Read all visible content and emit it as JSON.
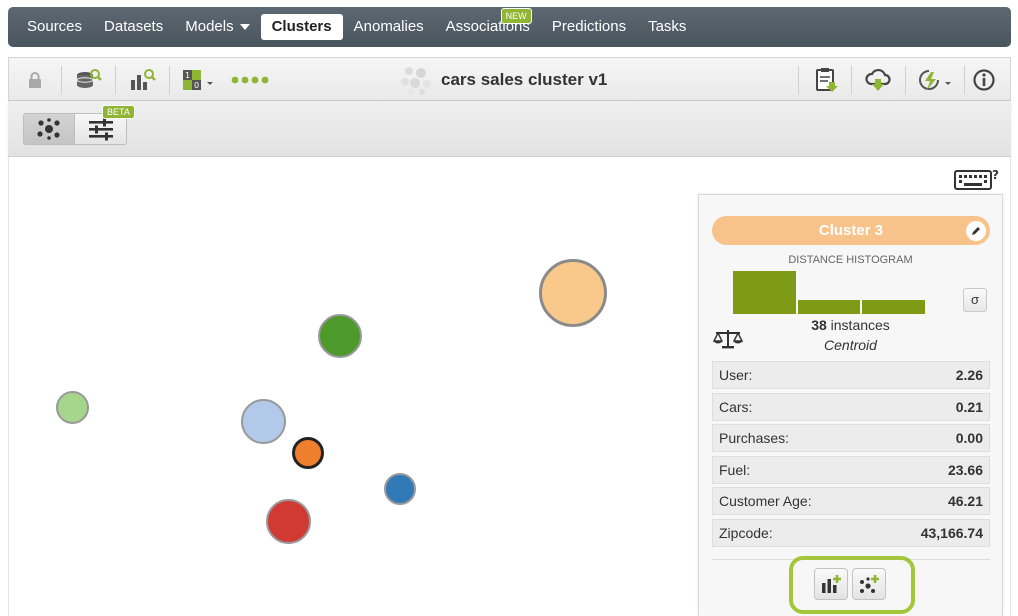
{
  "nav": {
    "items": [
      {
        "label": "Sources"
      },
      {
        "label": "Datasets"
      },
      {
        "label": "Models"
      },
      {
        "label": "Clusters"
      },
      {
        "label": "Anomalies"
      },
      {
        "label": "Associations"
      },
      {
        "label": "Predictions"
      },
      {
        "label": "Tasks"
      }
    ],
    "active": "Clusters",
    "new_badge": "NEW"
  },
  "toolbar": {
    "title": "cars sales cluster v1",
    "icons": [
      "lock-icon",
      "dataset-search-icon",
      "chart-search-icon",
      "binary-dropdown-icon",
      "dots-icon",
      "cluster-logo-icon",
      "report-download-icon",
      "cloud-download-icon",
      "lightning-dropdown-icon",
      "info-icon"
    ]
  },
  "subbar": {
    "beta_badge": "BETA",
    "views": [
      "cluster-view-icon",
      "sliders-view-icon"
    ]
  },
  "canvas": {
    "clusters": [
      {
        "name": "cluster-3",
        "color": "#f8c98b"
      },
      {
        "name": "cluster-green-dark",
        "color": "#4e9a2a"
      },
      {
        "name": "cluster-green-light",
        "color": "#a5d68c"
      },
      {
        "name": "cluster-blue-light",
        "color": "#b3c9e9"
      },
      {
        "name": "cluster-orange",
        "color": "#ee7f2d"
      },
      {
        "name": "cluster-blue",
        "color": "#3279b7"
      },
      {
        "name": "cluster-red",
        "color": "#d03a33"
      }
    ],
    "keyboard_help": "?"
  },
  "panel": {
    "cluster_name": "Cluster 3",
    "cluster_color": "#f7c38a",
    "histogram_title": "DISTANCE HISTOGRAM",
    "histogram": [
      1.0,
      0.33,
      0.33
    ],
    "sigma": "σ",
    "instances_count": "38",
    "instances_label": " instances",
    "centroid_label": "Centroid",
    "fields": [
      {
        "label": "User:",
        "value": "2.26"
      },
      {
        "label": "Cars:",
        "value": "0.21"
      },
      {
        "label": "Purchases:",
        "value": "0.00"
      },
      {
        "label": "Fuel:",
        "value": "23.66"
      },
      {
        "label": "Customer Age:",
        "value": "46.21"
      },
      {
        "label": "Zipcode:",
        "value": "43,166.74"
      }
    ]
  }
}
